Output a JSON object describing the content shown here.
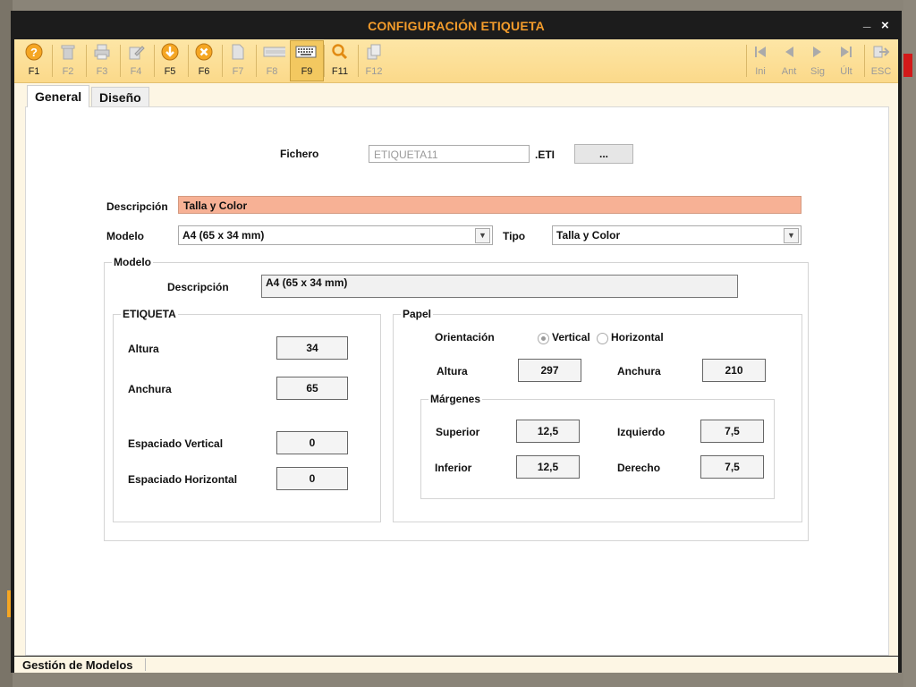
{
  "window": {
    "title": "CONFIGURACIÓN ETIQUETA",
    "minimize": "_",
    "close": "×"
  },
  "toolbar": {
    "left": [
      {
        "key": "F1",
        "icon": "help-icon",
        "enabled": true
      },
      {
        "key": "F2",
        "icon": "trash-icon",
        "enabled": false
      },
      {
        "key": "F3",
        "icon": "printer-icon",
        "enabled": false
      },
      {
        "key": "F4",
        "icon": "edit-icon",
        "enabled": false
      },
      {
        "key": "F5",
        "icon": "save-icon",
        "enabled": true
      },
      {
        "key": "F6",
        "icon": "cancel-icon",
        "enabled": true
      },
      {
        "key": "F7",
        "icon": "document-icon",
        "enabled": false
      },
      {
        "key": "F8",
        "icon": "list-icon",
        "enabled": false
      },
      {
        "key": "F9",
        "icon": "keyboard-icon",
        "enabled": true
      },
      {
        "key": "F11",
        "icon": "search-icon",
        "enabled": true
      },
      {
        "key": "F12",
        "icon": "copy-icon",
        "enabled": false
      }
    ],
    "right": [
      {
        "key": "Ini",
        "icon": "first-icon"
      },
      {
        "key": "Ant",
        "icon": "previous-icon"
      },
      {
        "key": "Sig",
        "icon": "next-icon"
      },
      {
        "key": "Últ",
        "icon": "last-icon"
      },
      {
        "key": "ESC",
        "icon": "exit-icon"
      }
    ]
  },
  "tabs": {
    "general": "General",
    "diseno": "Diseño"
  },
  "form": {
    "fichero_label": "Fichero",
    "fichero_value": "ETIQUETA11",
    "fichero_ext": ".ETI",
    "browse_label": "...",
    "descripcion_label": "Descripción",
    "descripcion_value": "Talla y Color",
    "modelo_label": "Modelo",
    "modelo_value": "A4 (65 x 34 mm)",
    "tipo_label": "Tipo",
    "tipo_value": "Talla y Color"
  },
  "modelo_group": {
    "legend": "Modelo",
    "descripcion_label": "Descripción",
    "descripcion_value": "A4 (65 x 34 mm)"
  },
  "etiqueta_group": {
    "legend": "ETIQUETA",
    "altura_label": "Altura",
    "altura_value": "34",
    "anchura_label": "Anchura",
    "anchura_value": "65",
    "esp_vertical_label": "Espaciado Vertical",
    "esp_vertical_value": "0",
    "esp_horizontal_label": "Espaciado Horizontal",
    "esp_horizontal_value": "0"
  },
  "papel_group": {
    "legend": "Papel",
    "orientacion_label": "Orientación",
    "vertical_label": "Vertical",
    "horizontal_label": "Horizontal",
    "orientacion_selected": "Vertical",
    "altura_label": "Altura",
    "altura_value": "297",
    "anchura_label": "Anchura",
    "anchura_value": "210"
  },
  "margenes_group": {
    "legend": "Márgenes",
    "superior_label": "Superior",
    "superior_value": "12,5",
    "inferior_label": "Inferior",
    "inferior_value": "12,5",
    "izquierdo_label": "Izquierdo",
    "izquierdo_value": "7,5",
    "derecho_label": "Derecho",
    "derecho_value": "7,5"
  },
  "statusbar": {
    "text": "Gestión de Modelos"
  },
  "colors": {
    "title": "#f39c2b",
    "toolbar": "#fbd98a",
    "highlight_field": "#f7b195",
    "window": "#1c1c1c"
  }
}
